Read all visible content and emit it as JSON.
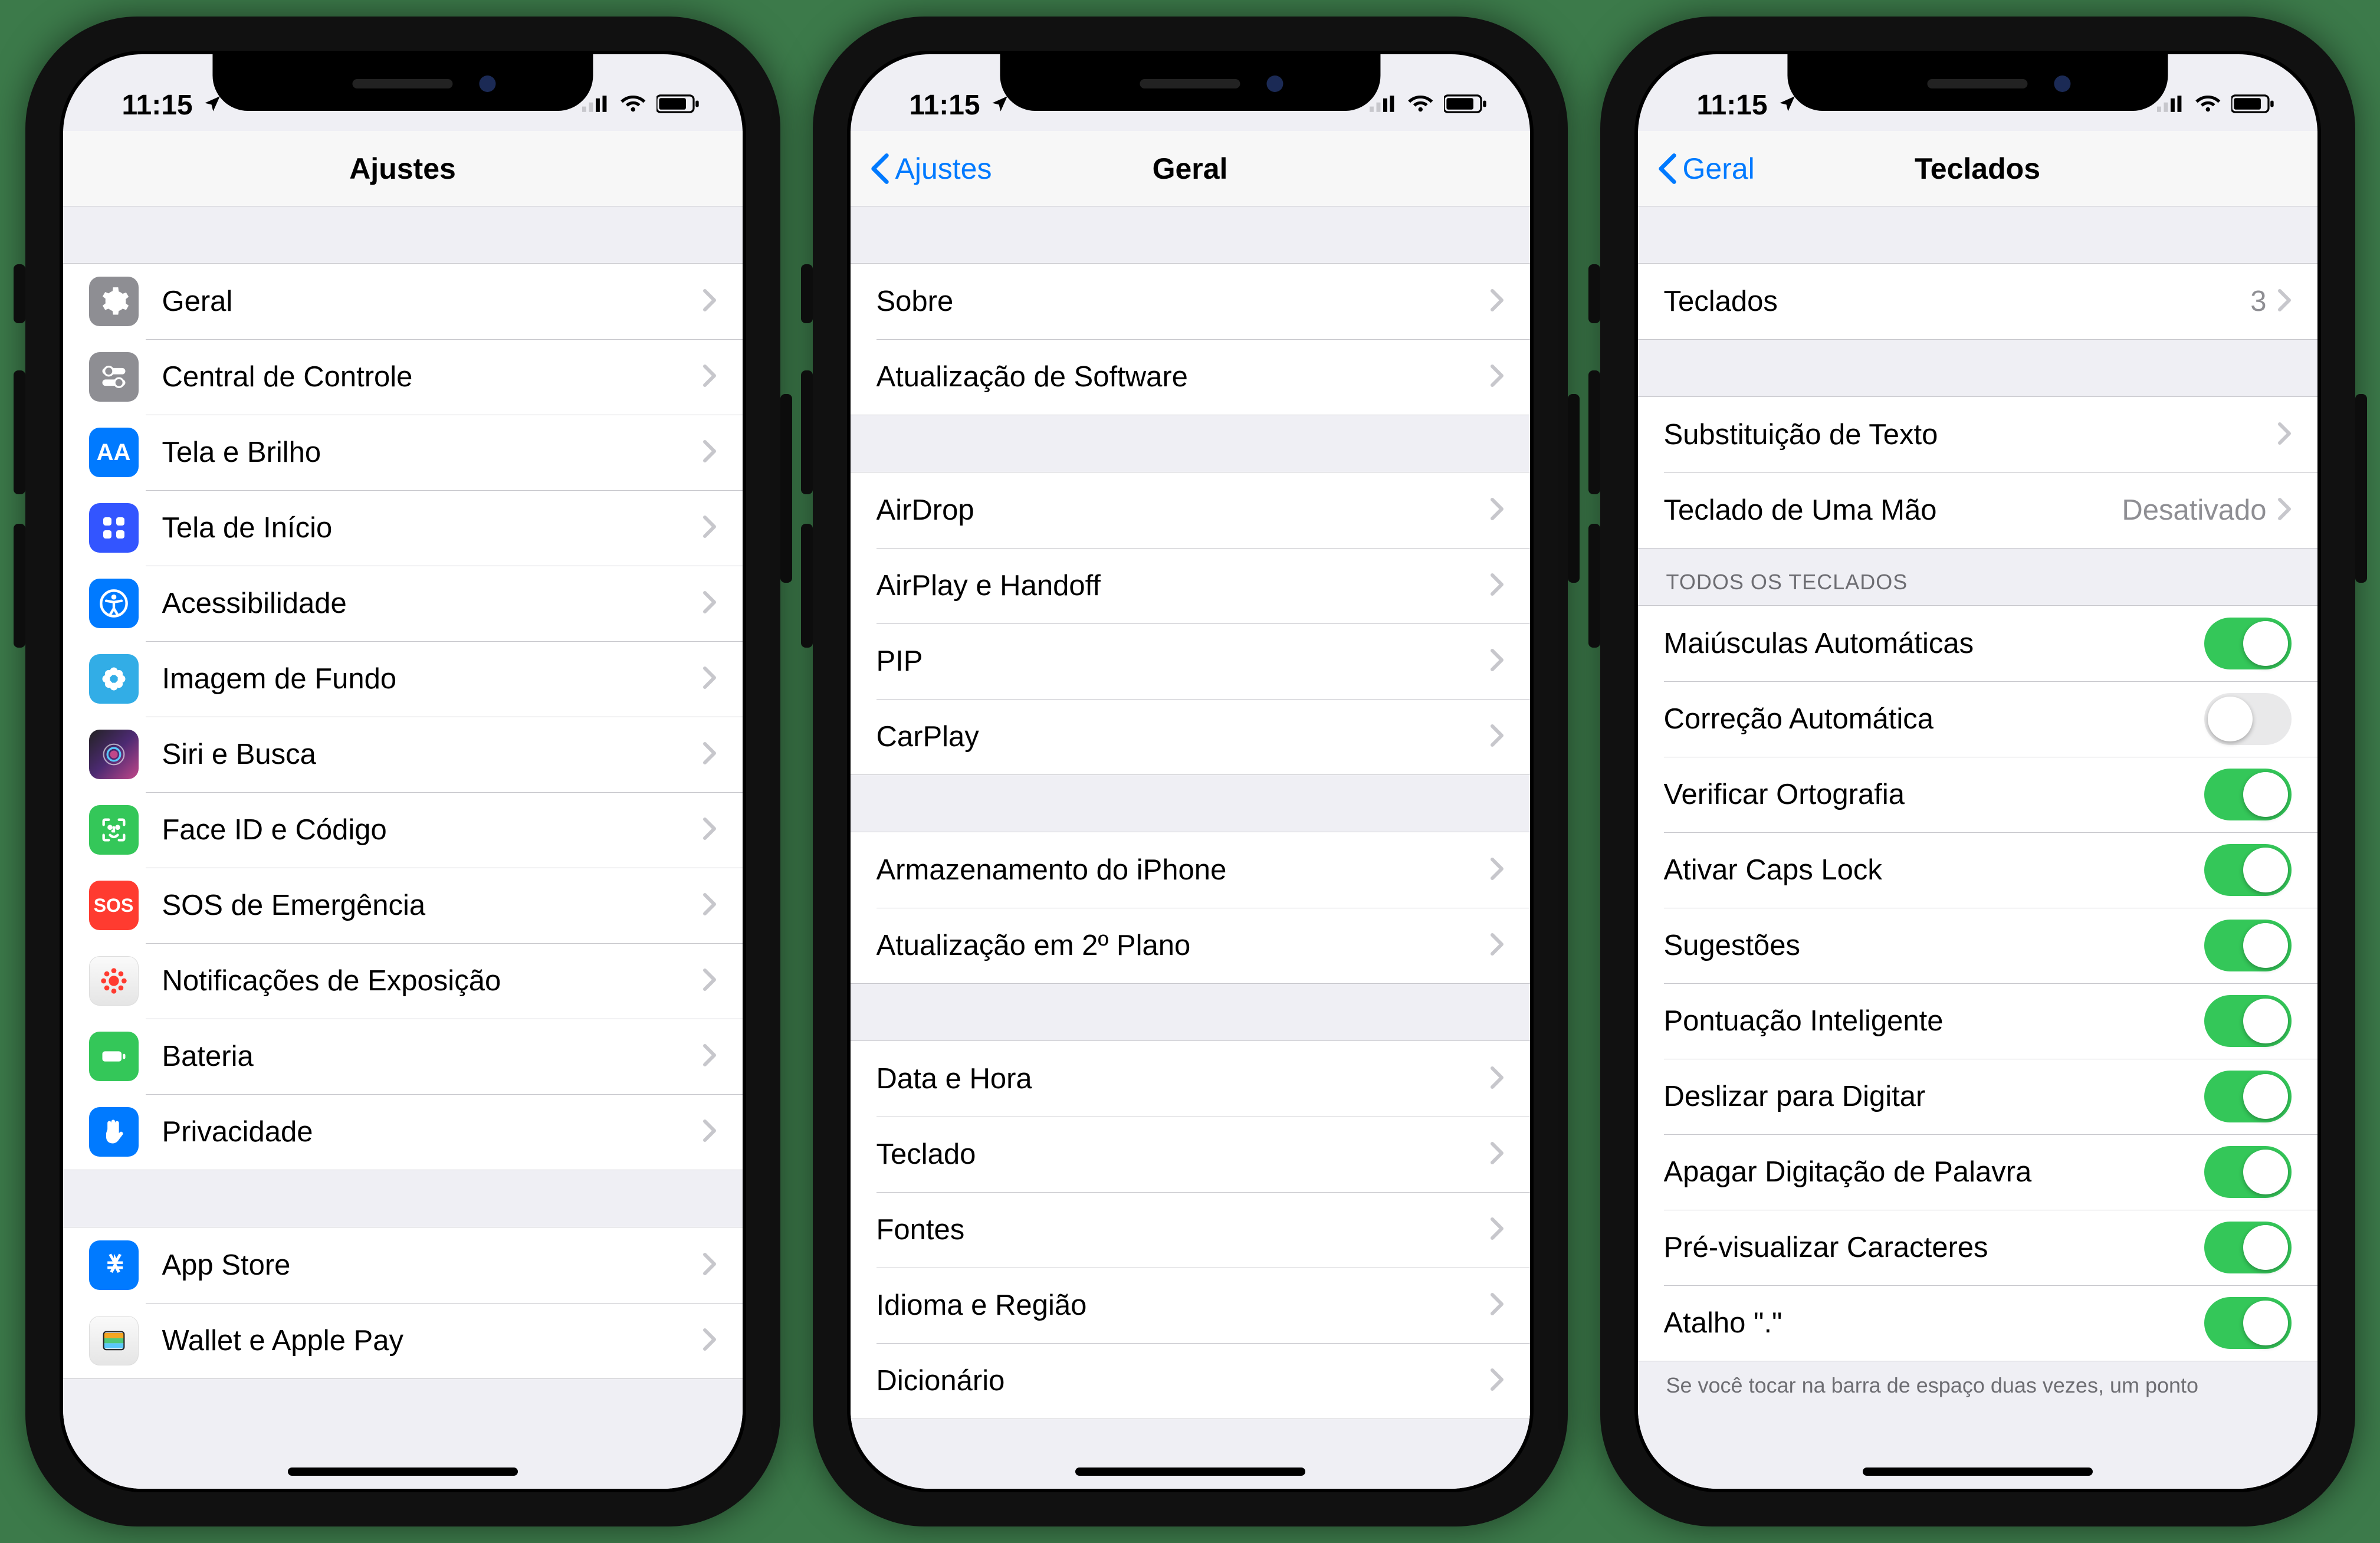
{
  "status": {
    "time": "11:15"
  },
  "phone1": {
    "title": "Ajustes",
    "groups": [
      {
        "items": [
          {
            "label": "Geral",
            "icon": "gear",
            "bg": "ic-gray"
          },
          {
            "label": "Central de Controle",
            "icon": "sliders",
            "bg": "ic-gray"
          },
          {
            "label": "Tela e Brilho",
            "icon": "aa",
            "bg": "ic-blue"
          },
          {
            "label": "Tela de Início",
            "icon": "grid",
            "bg": "ic-indigo"
          },
          {
            "label": "Acessibilidade",
            "icon": "accessibility",
            "bg": "ic-blue"
          },
          {
            "label": "Imagem de Fundo",
            "icon": "flower",
            "bg": "ic-cyan"
          },
          {
            "label": "Siri e Busca",
            "icon": "siri",
            "bg": "ic-siri"
          },
          {
            "label": "Face ID e Código",
            "icon": "faceid",
            "bg": "ic-green"
          },
          {
            "label": "SOS de Emergência",
            "icon": "sos",
            "bg": "ic-red"
          },
          {
            "label": "Notificações de Exposição",
            "icon": "virus",
            "bg": "ic-pink"
          },
          {
            "label": "Bateria",
            "icon": "battery",
            "bg": "ic-green"
          },
          {
            "label": "Privacidade",
            "icon": "hand",
            "bg": "ic-blue"
          }
        ]
      },
      {
        "items": [
          {
            "label": "App Store",
            "icon": "appstore",
            "bg": "ic-blue"
          },
          {
            "label": "Wallet e Apple Pay",
            "icon": "wallet",
            "bg": "ic-white"
          }
        ]
      }
    ]
  },
  "phone2": {
    "back": "Ajustes",
    "title": "Geral",
    "groups": [
      {
        "items": [
          {
            "label": "Sobre"
          },
          {
            "label": "Atualização de Software"
          }
        ]
      },
      {
        "items": [
          {
            "label": "AirDrop"
          },
          {
            "label": "AirPlay e Handoff"
          },
          {
            "label": "PIP"
          },
          {
            "label": "CarPlay"
          }
        ]
      },
      {
        "items": [
          {
            "label": "Armazenamento do iPhone"
          },
          {
            "label": "Atualização em 2º Plano"
          }
        ]
      },
      {
        "items": [
          {
            "label": "Data e Hora"
          },
          {
            "label": "Teclado"
          },
          {
            "label": "Fontes"
          },
          {
            "label": "Idioma e Região"
          },
          {
            "label": "Dicionário"
          }
        ]
      }
    ]
  },
  "phone3": {
    "back": "Geral",
    "title": "Teclados",
    "groups": [
      {
        "items": [
          {
            "label": "Teclados",
            "detail": "3"
          }
        ]
      },
      {
        "items": [
          {
            "label": "Substituição de Texto"
          },
          {
            "label": "Teclado de Uma Mão",
            "detail": "Desativado"
          }
        ]
      }
    ],
    "toggle_header": "TODOS OS TECLADOS",
    "toggles": [
      {
        "label": "Maiúsculas Automáticas",
        "on": true
      },
      {
        "label": "Correção Automática",
        "on": false
      },
      {
        "label": "Verificar Ortografia",
        "on": true
      },
      {
        "label": "Ativar Caps Lock",
        "on": true
      },
      {
        "label": "Sugestões",
        "on": true
      },
      {
        "label": "Pontuação Inteligente",
        "on": true
      },
      {
        "label": "Deslizar para Digitar",
        "on": true
      },
      {
        "label": "Apagar Digitação de Palavra",
        "on": true
      },
      {
        "label": "Pré-visualizar Caracteres",
        "on": true
      },
      {
        "label": "Atalho \".\"",
        "on": true
      }
    ],
    "footer": "Se você tocar na barra de espaço duas vezes, um ponto"
  }
}
